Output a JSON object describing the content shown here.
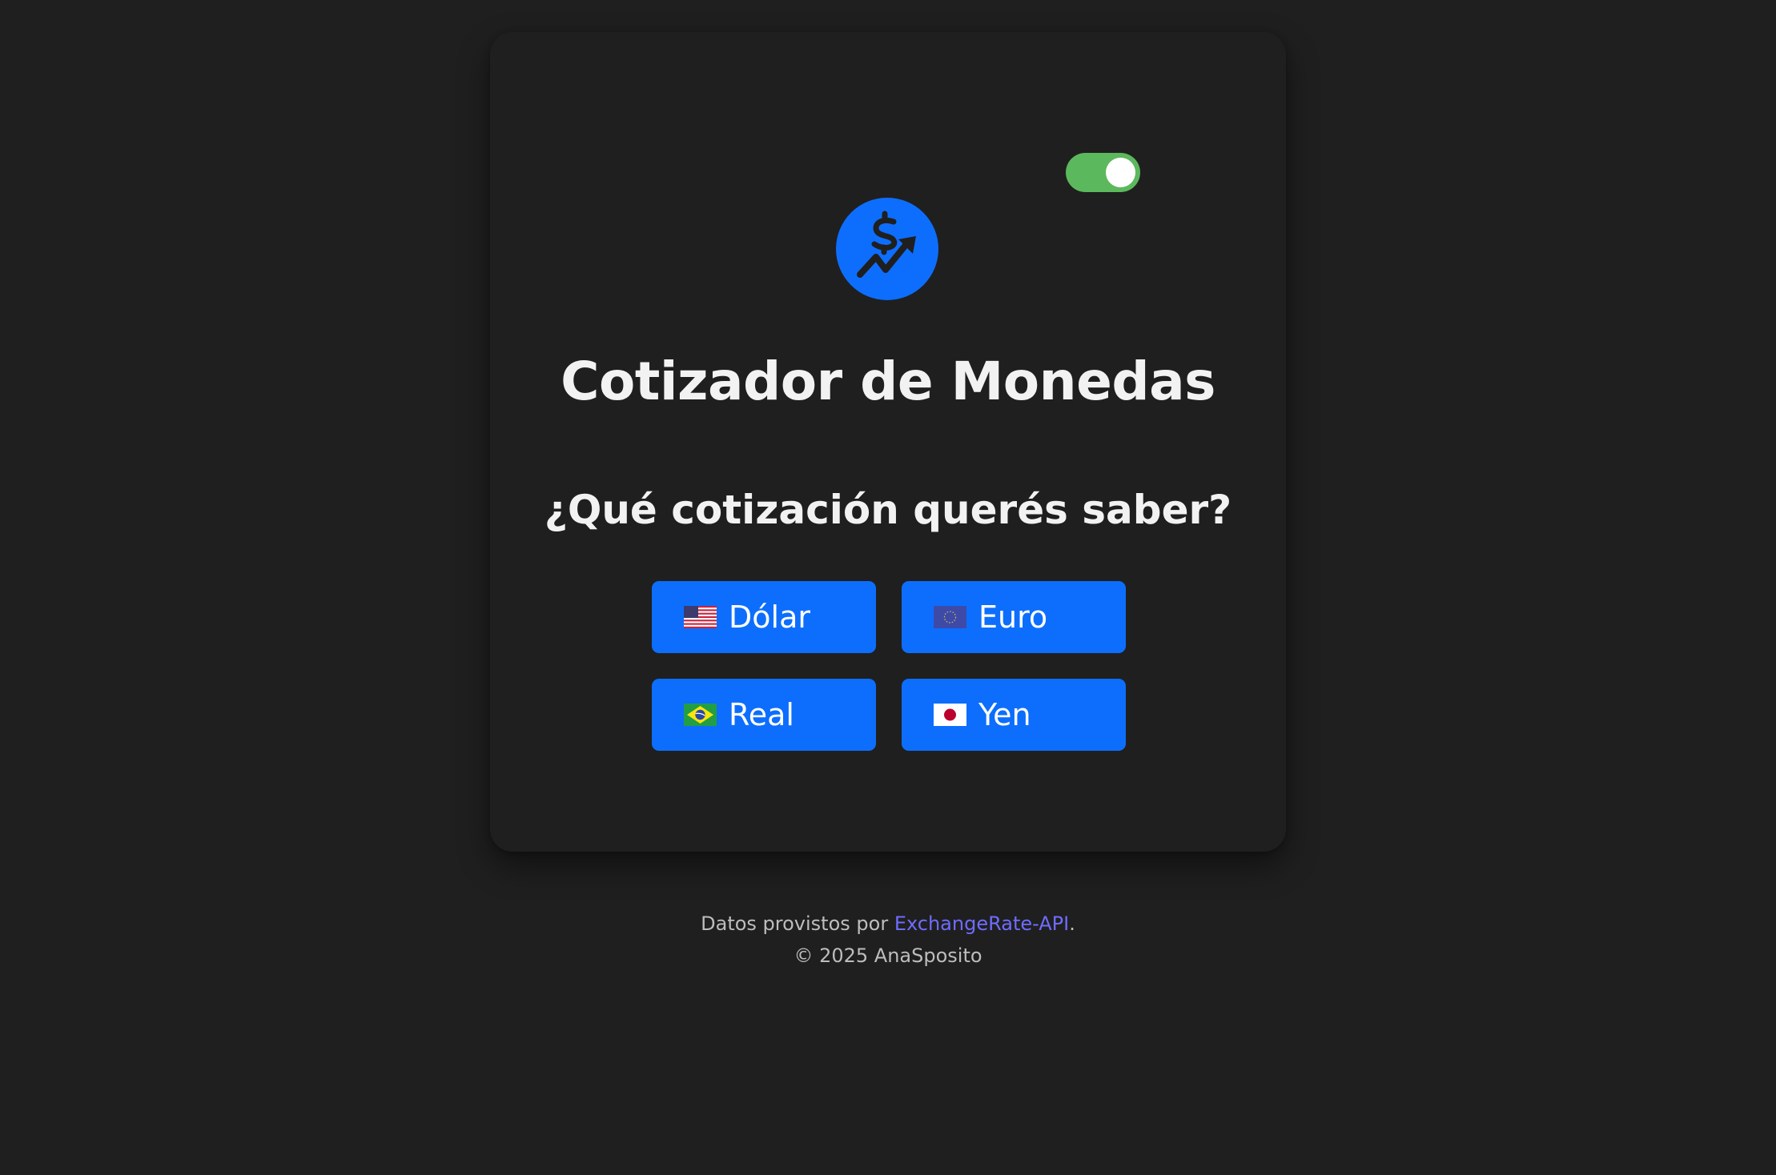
{
  "theme_toggle": {
    "state": "on",
    "color": "#5cb85c"
  },
  "logo": {
    "icon": "dollar-trend-icon",
    "color": "#0d6efd"
  },
  "header": {
    "title": "Cotizador de Monedas"
  },
  "main": {
    "question": "¿Qué cotización querés saber?",
    "buttons": [
      {
        "label": "Dólar",
        "flag": "us-flag-icon"
      },
      {
        "label": "Euro",
        "flag": "eu-flag-icon"
      },
      {
        "label": "Real",
        "flag": "br-flag-icon"
      },
      {
        "label": "Yen",
        "flag": "jp-flag-icon"
      }
    ],
    "button_color": "#0d6efd"
  },
  "footer": {
    "prefix": "Datos provistos por ",
    "link_text": "ExchangeRate-API",
    "suffix": ".",
    "copyright": "© 2025 AnaSposito",
    "link_color": "#6f6cff"
  }
}
